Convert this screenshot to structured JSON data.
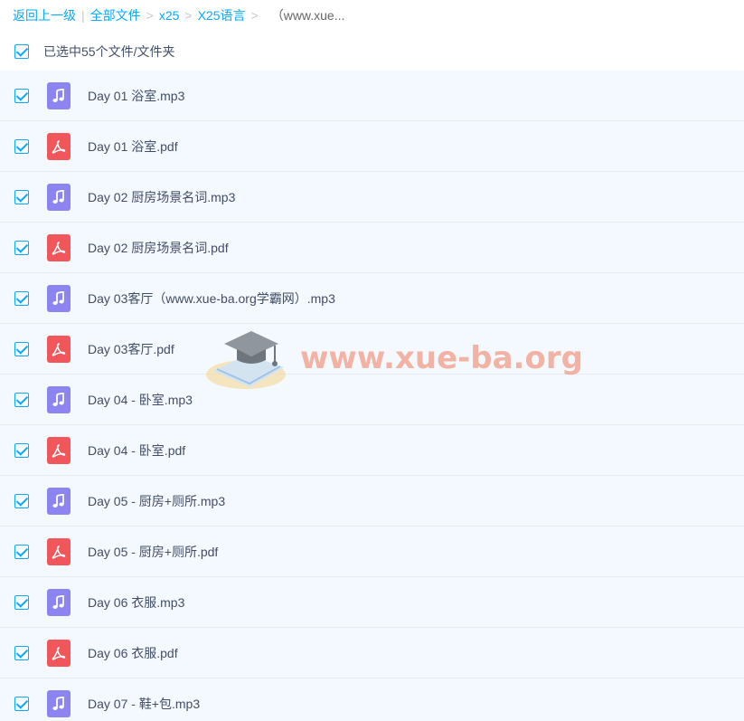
{
  "breadcrumb": {
    "back": "返回上一级",
    "all_files": "全部文件",
    "level1": "x25",
    "level2": "X25语言",
    "current": "（www.xue..."
  },
  "select_all": {
    "label": "已选中55个文件/文件夹"
  },
  "files": [
    {
      "name": "Day 01 浴室.mp3",
      "type": "audio"
    },
    {
      "name": "Day 01 浴室.pdf",
      "type": "pdf"
    },
    {
      "name": "Day 02 厨房场景名词.mp3",
      "type": "audio"
    },
    {
      "name": "Day 02 厨房场景名词.pdf",
      "type": "pdf"
    },
    {
      "name": "Day 03客厅（www.xue-ba.org学霸网）.mp3",
      "type": "audio"
    },
    {
      "name": "Day 03客厅.pdf",
      "type": "pdf"
    },
    {
      "name": "Day 04 - 卧室.mp3",
      "type": "audio"
    },
    {
      "name": "Day 04 - 卧室.pdf",
      "type": "pdf"
    },
    {
      "name": "Day 05 - 厨房+厕所.mp3",
      "type": "audio"
    },
    {
      "name": "Day 05 - 厨房+厕所.pdf",
      "type": "pdf"
    },
    {
      "name": "Day 06 衣服.mp3",
      "type": "audio"
    },
    {
      "name": "Day 06 衣服.pdf",
      "type": "pdf"
    },
    {
      "name": "Day 07 - 鞋+包.mp3",
      "type": "audio"
    }
  ],
  "watermark": {
    "text": "www.xue-ba.org"
  },
  "colors": {
    "link": "#09AAFF",
    "audio_icon": "#8c84f0",
    "pdf_icon": "#f0565a",
    "row_bg": "#f4f9ff"
  }
}
